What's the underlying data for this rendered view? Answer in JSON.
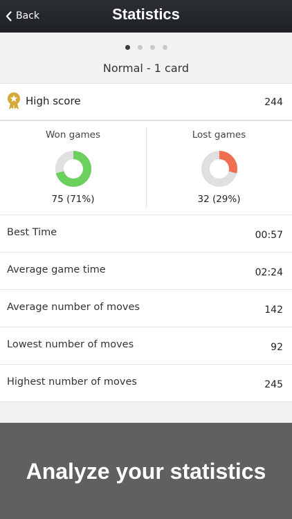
{
  "nav": {
    "back_label": "Back",
    "title": "Statistics"
  },
  "pager": {
    "count": 4,
    "active": 0
  },
  "subtitle": "Normal - 1 card",
  "high_score": {
    "label": "High score",
    "value": "244"
  },
  "games": {
    "won": {
      "label": "Won games",
      "value_text": "75 (71%)",
      "fraction": 0.71,
      "color": "#6bd05e"
    },
    "lost": {
      "label": "Lost games",
      "value_text": "32 (29%)",
      "fraction": 0.29,
      "color": "#ef6f50"
    }
  },
  "rows": [
    {
      "label": "Best Time",
      "value": "00:57"
    },
    {
      "label": "Average game time",
      "value": "02:24"
    },
    {
      "label": "Average number of moves",
      "value": "142"
    },
    {
      "label": "Lowest number of moves",
      "value": "92"
    },
    {
      "label": "Highest number of moves",
      "value": "245"
    }
  ],
  "banner": {
    "text": "Analyze your statistics"
  },
  "colors": {
    "nav_bg": "#24282c",
    "medal": "#d4a93a",
    "donut_track": "#e0e0e0",
    "banner_bg": "#606060"
  }
}
